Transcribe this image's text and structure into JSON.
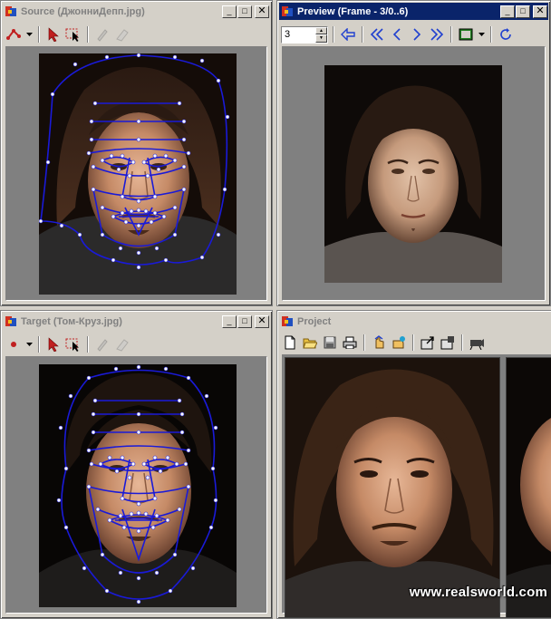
{
  "source_window": {
    "title": "Source (ДжонниДепп.jpg)",
    "title_state": "inactive",
    "buttons": {
      "minimize": "_",
      "maximize": "□",
      "close": "✕"
    },
    "tools": [
      "add-point-icon",
      "dropdown-arrow-icon",
      "select-arrow-icon",
      "select-region-icon",
      "pen-icon",
      "eraser-icon"
    ]
  },
  "preview_window": {
    "title": "Preview (Frame - 3/0..6)",
    "title_state": "active",
    "frame_value": "3",
    "buttons": {
      "minimize": "_",
      "maximize": "□",
      "close": "✕"
    },
    "tools": [
      "back-arrow-icon",
      "first-frame-icon",
      "prev-frame-icon",
      "next-frame-icon",
      "last-frame-icon",
      "frame-view-icon",
      "dropdown-arrow-icon",
      "loop-icon"
    ]
  },
  "target_window": {
    "title": "Target (Том-Круз.jpg)",
    "title_state": "inactive",
    "buttons": {
      "minimize": "_",
      "maximize": "□",
      "close": "✕"
    },
    "tools": [
      "point-icon",
      "dropdown-arrow-icon",
      "select-arrow-icon",
      "select-region-icon",
      "pen-icon",
      "eraser-icon"
    ]
  },
  "project_window": {
    "title": "Project",
    "title_state": "inactive",
    "tools": [
      "new-file-icon",
      "open-folder-icon",
      "save-icon",
      "print-icon",
      "hand-up-icon",
      "hand-right-icon",
      "export-icon",
      "settings-icon",
      "camera-icon"
    ]
  },
  "watermark": "www.realsworld.com",
  "colors": {
    "active_title": "#0a246a",
    "face_mesh": "#1a1ad8",
    "window_bg": "#d4d0c8",
    "pane_bg": "#808080"
  }
}
